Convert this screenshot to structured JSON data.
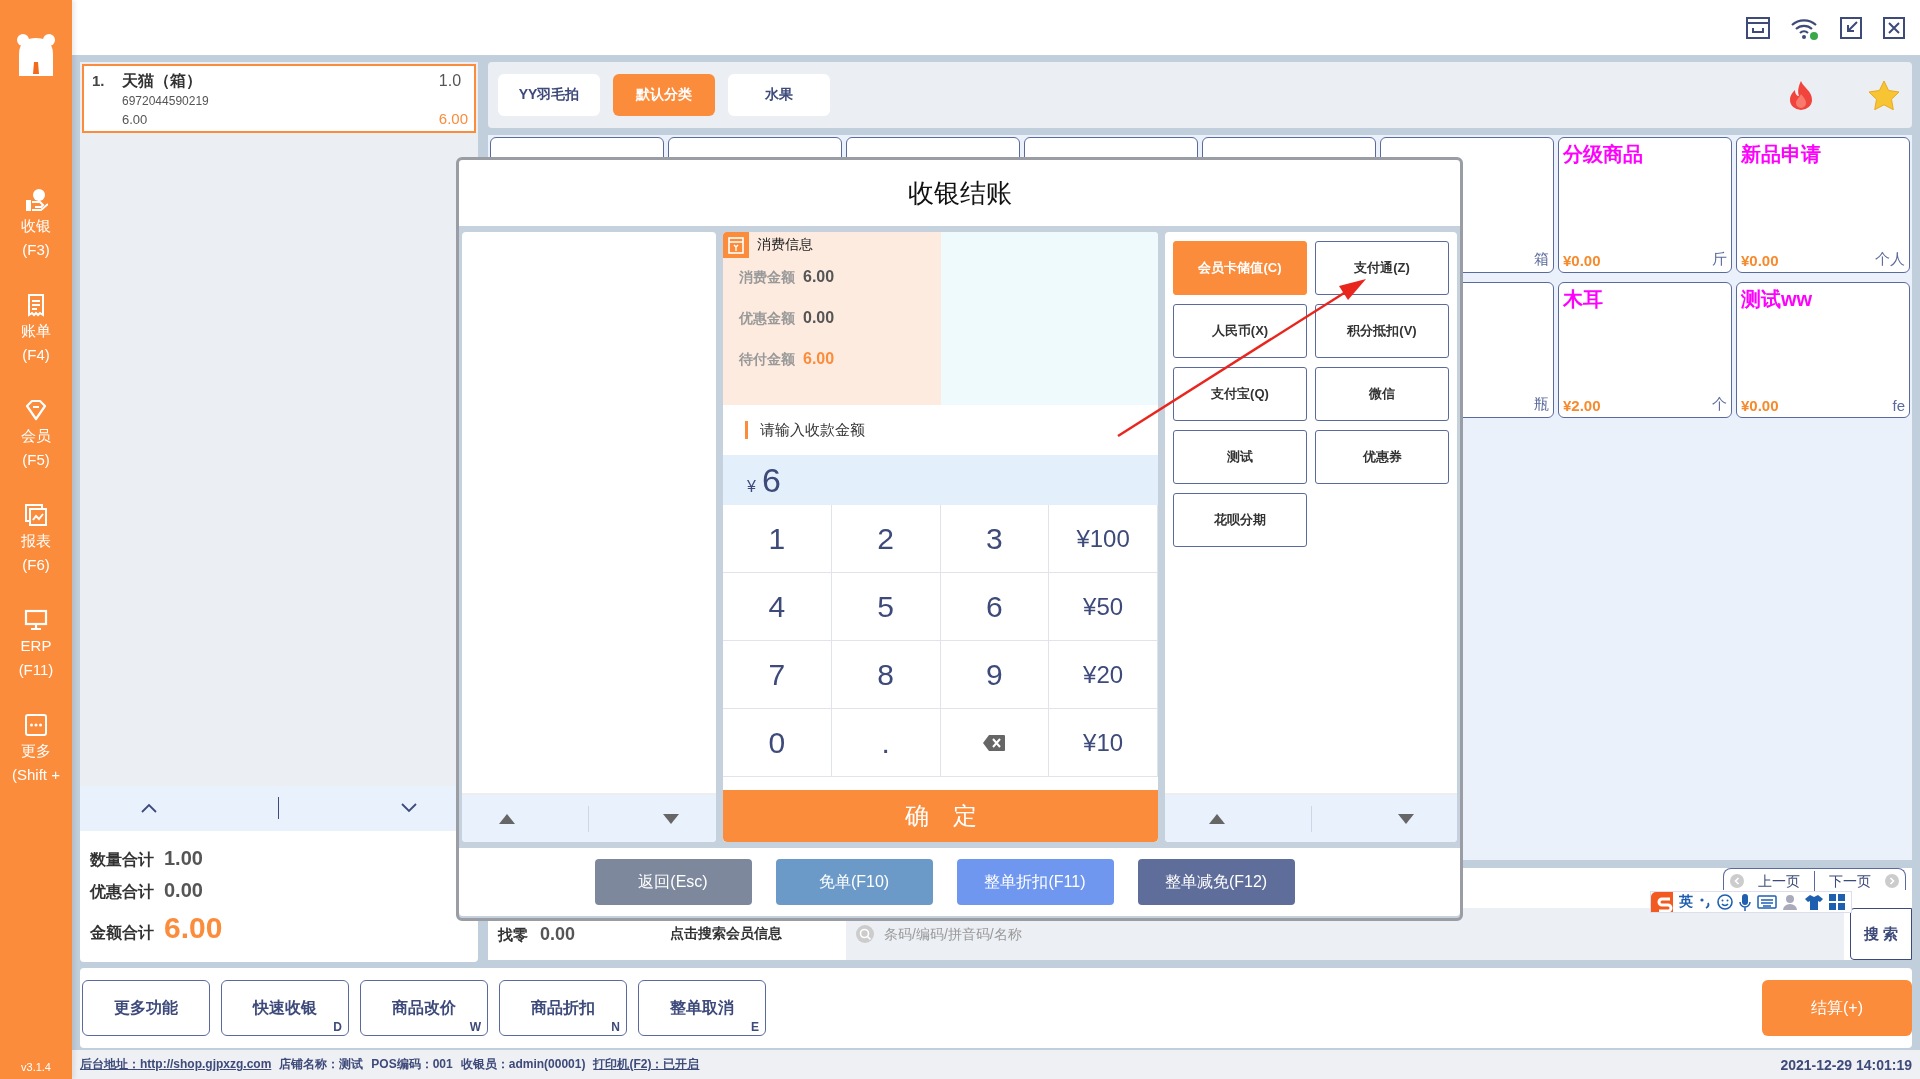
{
  "app": {
    "version": "v3.1.4"
  },
  "nav": [
    {
      "label": "收银",
      "hotkey": "(F3)"
    },
    {
      "label": "账单",
      "hotkey": "(F4)"
    },
    {
      "label": "会员",
      "hotkey": "(F5)"
    },
    {
      "label": "报表",
      "hotkey": "(F6)"
    },
    {
      "label": "ERP",
      "hotkey": "(F11)"
    },
    {
      "label": "更多",
      "hotkey": "(Shift +"
    }
  ],
  "cart": {
    "items": [
      {
        "index": "1.",
        "name": "天猫（箱）",
        "qty": "1.0",
        "barcode": "6972044590219",
        "price": "6.00",
        "subtotal": "6.00",
        "selected": true
      }
    ]
  },
  "totals": [
    {
      "label": "数量合计",
      "value": "1.00",
      "kind": "plain"
    },
    {
      "label": "优惠合计",
      "value": "0.00",
      "kind": "plain"
    },
    {
      "label": "金额合计",
      "value": "6.00",
      "kind": "total"
    }
  ],
  "categories": [
    {
      "label": "YY羽毛拍",
      "selected": false
    },
    {
      "label": "默认分类",
      "selected": true
    },
    {
      "label": "水果",
      "selected": false
    }
  ],
  "products": {
    "rows": [
      [
        {},
        {},
        {},
        {},
        {},
        {
          "unit": "箱"
        },
        {
          "name": "分级商品",
          "price": "¥0.00",
          "unit": "斤"
        },
        {
          "name": "新品申请",
          "price": "¥0.00",
          "unit": "个人"
        }
      ],
      [
        "",
        "",
        "",
        "",
        "",
        {
          "unit": "瓶"
        },
        {
          "name": "木耳",
          "price": "¥2.00",
          "unit": "个"
        },
        {
          "name": "测试ww",
          "price": "¥0.00",
          "unit": "fe"
        }
      ]
    ]
  },
  "pager": {
    "prev": "上一页",
    "next": "下一页"
  },
  "change": {
    "label": "找零",
    "value": "0.00"
  },
  "member_search": "点击搜索会员信息",
  "search": {
    "placeholder": "条码/编码/拼音码/名称",
    "button": "搜 索"
  },
  "actions": [
    {
      "label": "更多功能"
    },
    {
      "label": "快速收银",
      "hotkey": "D"
    },
    {
      "label": "商品改价",
      "hotkey": "W"
    },
    {
      "label": "商品折扣",
      "hotkey": "N"
    },
    {
      "label": "整单取消",
      "hotkey": "E"
    }
  ],
  "checkout": "结算(+)",
  "status_bar": {
    "items": [
      {
        "text": "后台地址：http://shop.gjpxzg.com",
        "kind": "link"
      },
      {
        "text": "店铺名称：测试",
        "kind": "plain"
      },
      {
        "text": "POS编码：001",
        "kind": "plain"
      },
      {
        "text": "收银员：admin(00001)",
        "kind": "plain"
      },
      {
        "text": "打印机(F2)：已开启",
        "kind": "link"
      }
    ],
    "datetime": "2021-12-29 14:01:19"
  },
  "ime": {
    "language": "英"
  },
  "dialog": {
    "title": "收银结账",
    "info_title": "消费信息",
    "info": [
      {
        "label": "消费金额",
        "value": "6.00",
        "kind": "plain"
      },
      {
        "label": "优惠金额",
        "value": "0.00",
        "kind": "plain"
      },
      {
        "label": "待付金额",
        "value": "6.00",
        "kind": "due"
      }
    ],
    "prompt": "请输入收款金额",
    "currency": "¥",
    "amount": "6",
    "keys": [
      {
        "label": "1",
        "kind": "digit"
      },
      {
        "label": "2",
        "kind": "digit"
      },
      {
        "label": "3",
        "kind": "digit"
      },
      {
        "label": "¥100",
        "kind": "preset"
      },
      {
        "label": "4",
        "kind": "digit"
      },
      {
        "label": "5",
        "kind": "digit"
      },
      {
        "label": "6",
        "kind": "digit"
      },
      {
        "label": "¥50",
        "kind": "preset"
      },
      {
        "label": "7",
        "kind": "digit"
      },
      {
        "label": "8",
        "kind": "digit"
      },
      {
        "label": "9",
        "kind": "digit"
      },
      {
        "label": "¥20",
        "kind": "preset"
      },
      {
        "label": "0",
        "kind": "digit"
      },
      {
        "label": ".",
        "kind": "digit"
      },
      {
        "kind": "backspace"
      },
      {
        "label": "¥10",
        "kind": "preset"
      }
    ],
    "confirm": "确　定",
    "payments": [
      {
        "label": "会员卡储值(C)",
        "selected": true
      },
      {
        "label": "支付通(Z)",
        "selected": false
      },
      {
        "label": "人民币(X)",
        "selected": false
      },
      {
        "label": "积分抵扣(V)",
        "selected": false
      },
      {
        "label": "支付宝(Q)",
        "selected": false
      },
      {
        "label": "微信",
        "selected": false
      },
      {
        "label": "测试",
        "selected": false
      },
      {
        "label": "优惠券",
        "selected": false
      },
      {
        "label": "花呗分期",
        "selected": false
      }
    ],
    "buttons": [
      {
        "label": "返回(Esc)",
        "kind": "back"
      },
      {
        "label": "免单(F10)",
        "kind": "free"
      },
      {
        "label": "整单折扣(F11)",
        "kind": "discount"
      },
      {
        "label": "整单减免(F12)",
        "kind": "reduce"
      }
    ]
  }
}
